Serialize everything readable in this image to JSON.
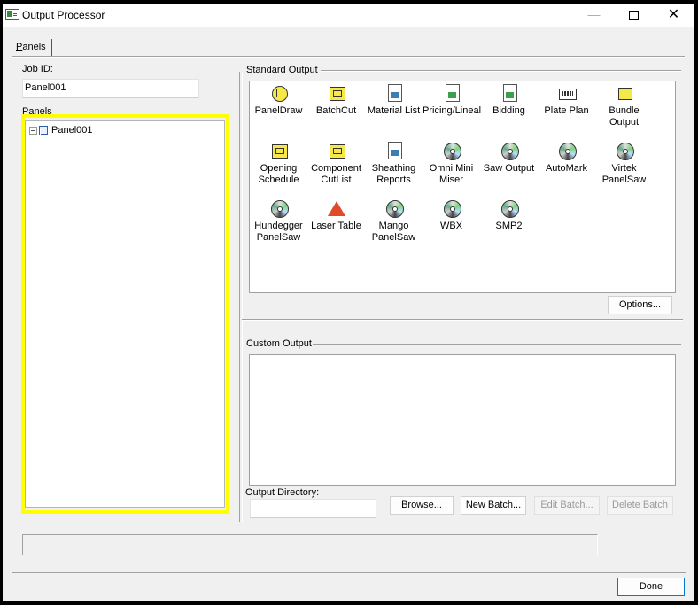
{
  "window": {
    "title": "Output Processor",
    "minimize_glyph": "—",
    "close_glyph": "✕"
  },
  "tabs": [
    {
      "label_underlined": "P",
      "label_rest": "anels"
    }
  ],
  "left": {
    "job_id_label": "Job ID:",
    "job_id_value": "Panel001",
    "panels_label": "Panels",
    "tree_items": [
      {
        "label": "Panel001"
      }
    ]
  },
  "standard_output": {
    "label": "Standard Output",
    "items": [
      {
        "line1": "PanelDraw",
        "line2": "",
        "icon": "round-yellow-icon"
      },
      {
        "line1": "BatchCut",
        "line2": "",
        "icon": "yellow-tray-icon"
      },
      {
        "line1": "Material List",
        "line2": "",
        "icon": "report-doc-icon"
      },
      {
        "line1": "Pricing/Lineal",
        "line2": "",
        "icon": "report-doc-green-icon"
      },
      {
        "line1": "Bidding",
        "line2": "",
        "icon": "report-doc-green-icon"
      },
      {
        "line1": "Plate Plan",
        "line2": "",
        "icon": "plate-icon"
      },
      {
        "line1": "Bundle",
        "line2": "Output",
        "icon": "bundle-icon"
      },
      {
        "line1": "Opening",
        "line2": "Schedule",
        "icon": "yellow-tray-icon"
      },
      {
        "line1": "Component",
        "line2": "CutList",
        "icon": "yellow-tray-icon"
      },
      {
        "line1": "Sheathing",
        "line2": "Reports",
        "icon": "report-doc-icon"
      },
      {
        "line1": "Omni Mini",
        "line2": "Miser",
        "icon": "disc-icon"
      },
      {
        "line1": "Saw Output",
        "line2": "",
        "icon": "disc-icon"
      },
      {
        "line1": "AutoMark",
        "line2": "",
        "icon": "disc-icon"
      },
      {
        "line1": "Virtek",
        "line2": "PanelSaw",
        "icon": "disc-icon"
      },
      {
        "line1": "Hundegger",
        "line2": "PanelSaw",
        "icon": "disc-icon"
      },
      {
        "line1": "Laser Table",
        "line2": "",
        "icon": "laser-icon"
      },
      {
        "line1": "Mango",
        "line2": "PanelSaw",
        "icon": "disc-icon"
      },
      {
        "line1": "WBX",
        "line2": "",
        "icon": "disc-icon"
      },
      {
        "line1": "SMP2",
        "line2": "",
        "icon": "disc-icon"
      }
    ],
    "options_button": "Options..."
  },
  "custom_output": {
    "label": "Custom Output",
    "output_directory_label": "Output Directory:",
    "output_directory_value": "",
    "browse_button": "Browse...",
    "new_batch_button": "New Batch...",
    "edit_batch_button": "Edit Batch...",
    "delete_batch_button": "Delete Batch"
  },
  "footer": {
    "done_button": "Done"
  },
  "colors": {
    "highlight": "#ffff00",
    "window_bg": "#f0f0f0",
    "accent": "#0078d4"
  }
}
